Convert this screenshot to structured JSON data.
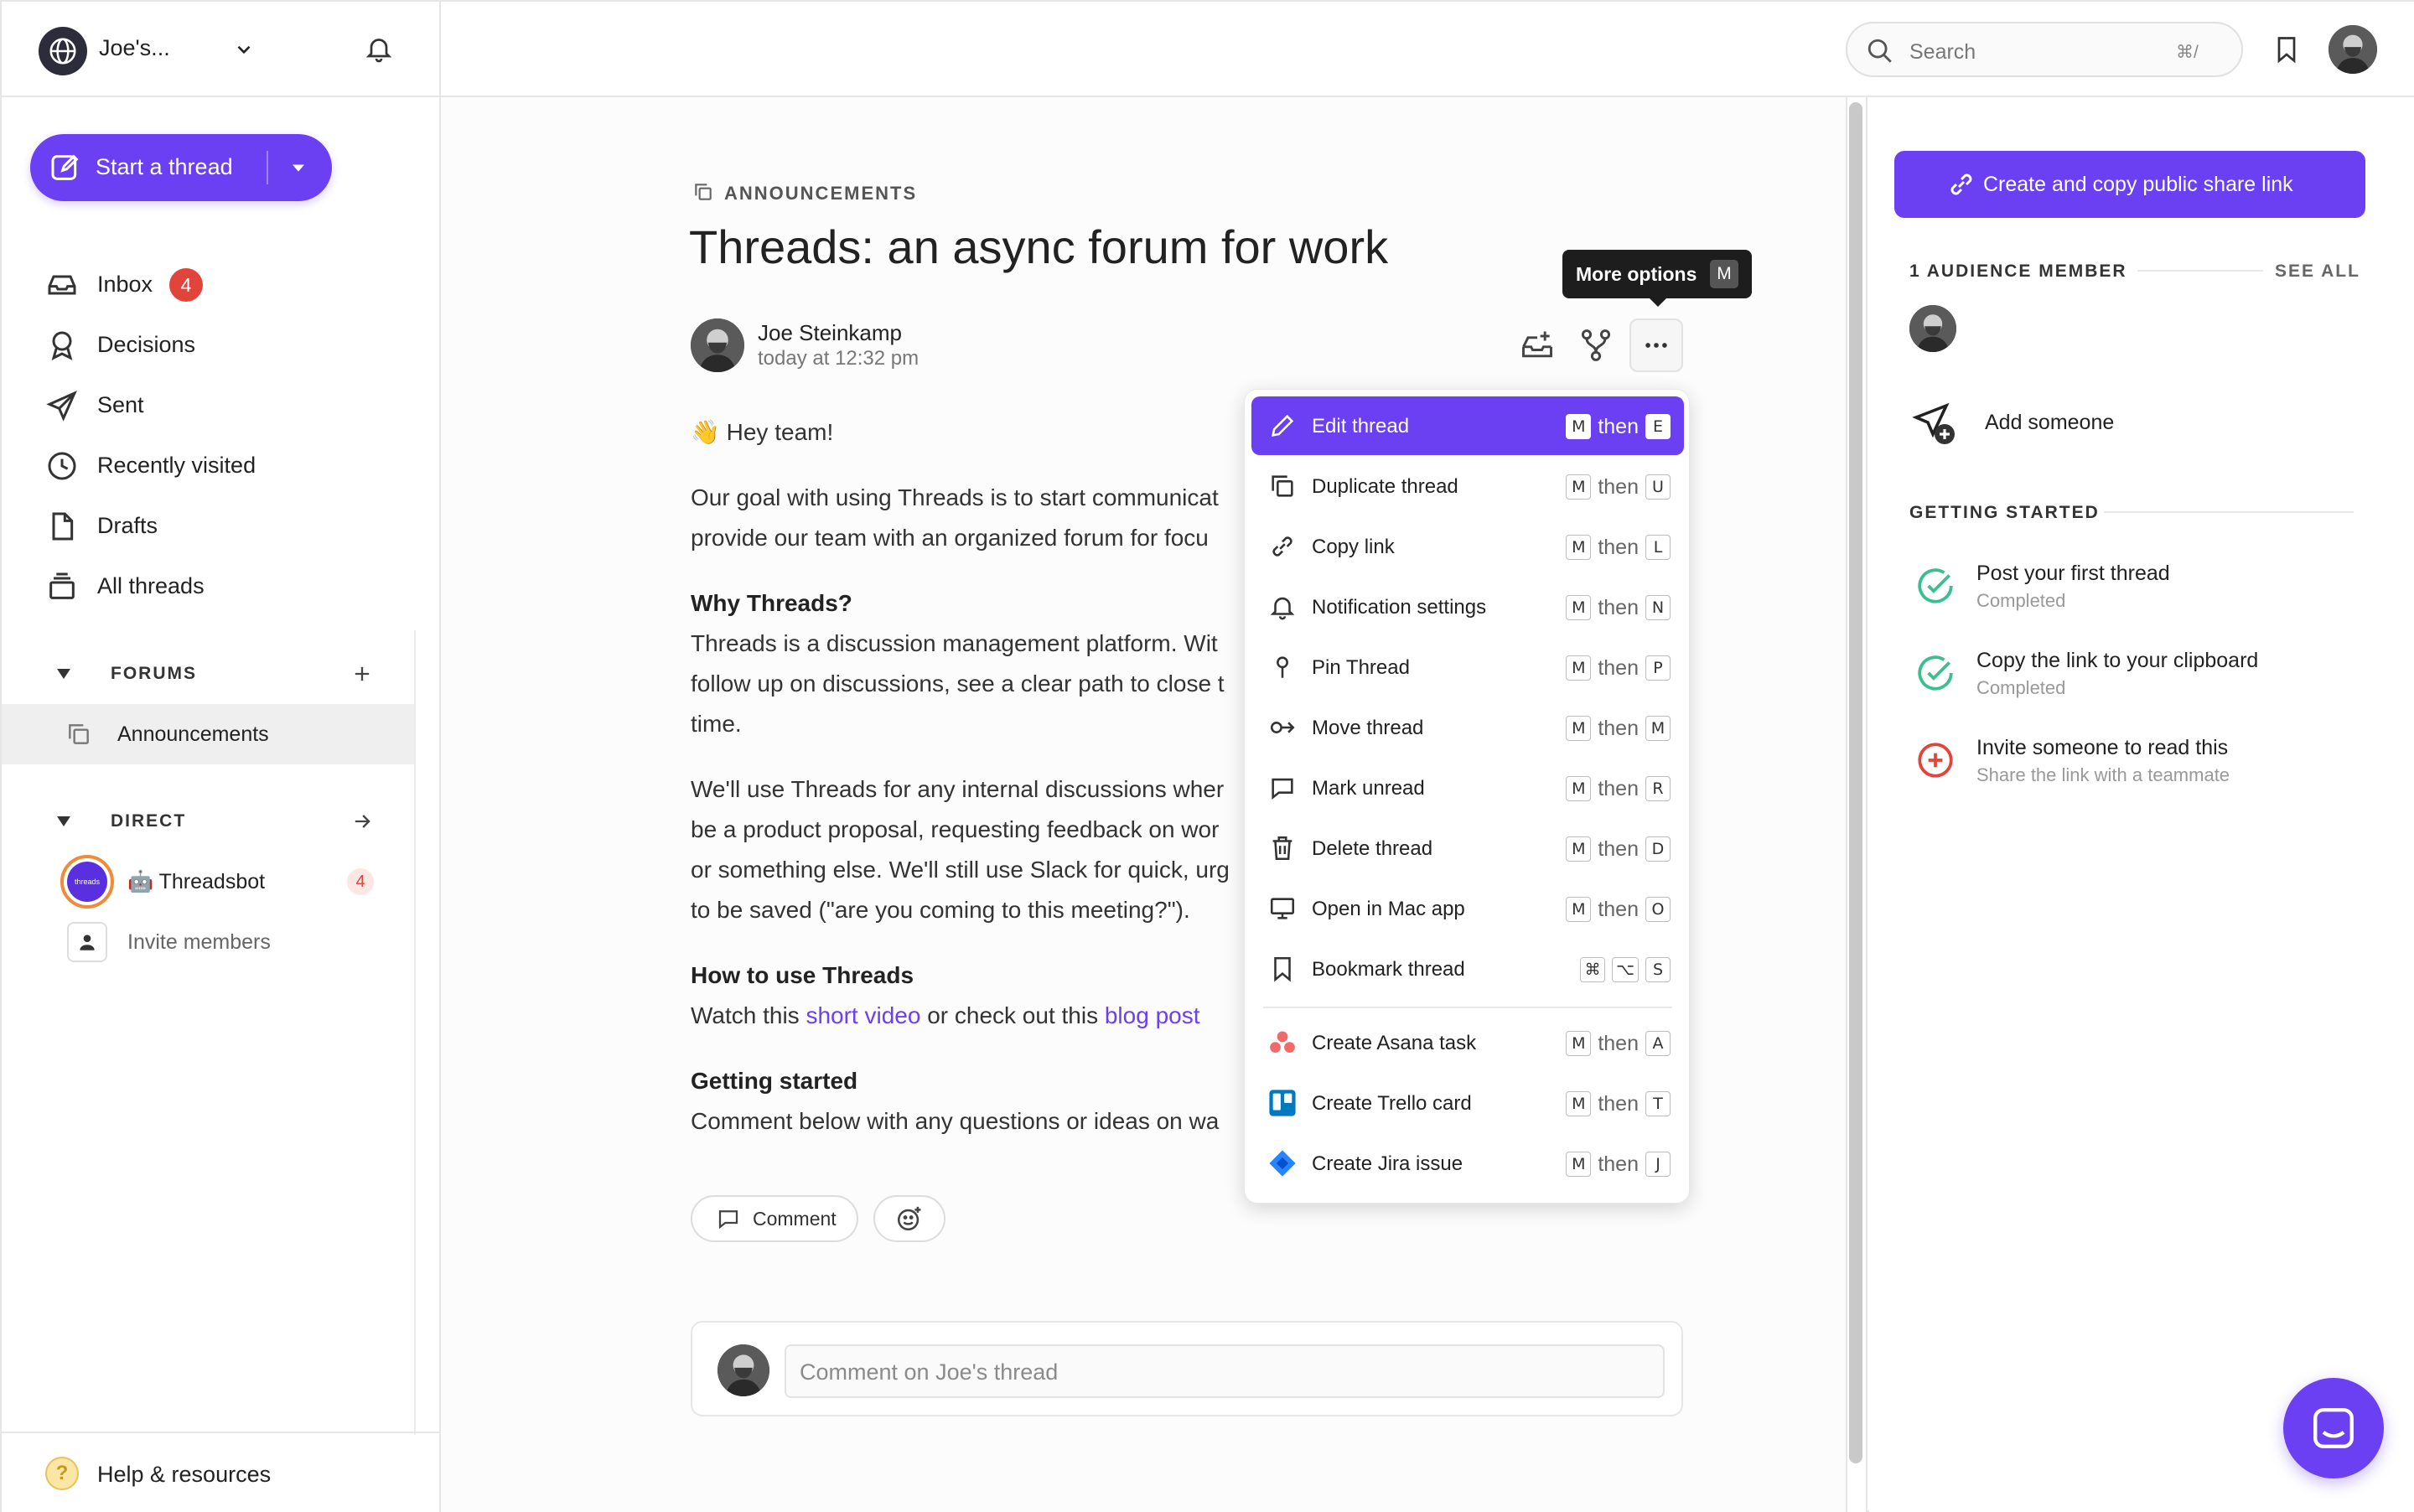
{
  "workspace": {
    "name": "Joe's..."
  },
  "sidebar": {
    "start_thread_label": "Start a thread",
    "nav": [
      {
        "label": "Inbox",
        "badge": "4",
        "icon": "inbox-icon"
      },
      {
        "label": "Decisions",
        "icon": "ribbon-icon"
      },
      {
        "label": "Sent",
        "icon": "send-icon"
      },
      {
        "label": "Recently visited",
        "icon": "clock-icon"
      },
      {
        "label": "Drafts",
        "icon": "file-icon"
      },
      {
        "label": "All threads",
        "icon": "stack-icon"
      }
    ],
    "forums_label": "FORUMS",
    "forums": [
      {
        "label": "Announcements"
      }
    ],
    "direct_label": "DIRECT",
    "direct": [
      {
        "name": "🤖 Threadsbot",
        "badge": "4",
        "avatar_text": "threads"
      }
    ],
    "invite_label": "Invite members",
    "help_label": "Help & resources"
  },
  "topbar": {
    "search_placeholder": "Search",
    "search_shortcut": "⌘/"
  },
  "thread": {
    "forum": "ANNOUNCEMENTS",
    "title": "Threads: an async forum for work",
    "author": "Joe Steinkamp",
    "time": "today at 12:32 pm",
    "greeting": "👋 Hey team!",
    "p1_line1": "Our goal with using Threads is to start communicat",
    "p1_line2": "provide our team with an organized forum for focu",
    "h_why": "Why Threads?",
    "why_line1": "Threads is a discussion management platform. Wit",
    "why_line2": "follow up on discussions, see a clear path to close t",
    "why_line3": "time.",
    "use_line1": "We'll use Threads for any internal discussions wher",
    "use_line2": "be a product proposal, requesting feedback on wor",
    "use_line3": "or something else. We'll still use Slack for quick, urg",
    "use_line4": "to be saved (\"are you coming to this meeting?\").",
    "h_how": "How to use Threads",
    "how_prefix": "Watch this ",
    "how_link1": "short video",
    "how_mid": " or check out this ",
    "how_link2": "blog post",
    "h_getting": "Getting started",
    "getting_line": "Comment below with any questions or ideas on wa",
    "comment_button": "Comment",
    "comment_placeholder": "Comment on Joe's thread"
  },
  "tooltip": {
    "label": "More options",
    "key": "M"
  },
  "menu": {
    "items": [
      {
        "label": "Edit thread",
        "icon": "pencil-icon",
        "keys": [
          "M",
          "then",
          "E"
        ],
        "active": true
      },
      {
        "label": "Duplicate thread",
        "icon": "duplicate-icon",
        "keys": [
          "M",
          "then",
          "U"
        ]
      },
      {
        "label": "Copy link",
        "icon": "link-icon",
        "keys": [
          "M",
          "then",
          "L"
        ]
      },
      {
        "label": "Notification settings",
        "icon": "bell-icon",
        "keys": [
          "M",
          "then",
          "N"
        ]
      },
      {
        "label": "Pin Thread",
        "icon": "pin-icon",
        "keys": [
          "M",
          "then",
          "P"
        ]
      },
      {
        "label": "Move thread",
        "icon": "move-icon",
        "keys": [
          "M",
          "then",
          "M"
        ]
      },
      {
        "label": "Mark unread",
        "icon": "comment-icon",
        "keys": [
          "M",
          "then",
          "R"
        ]
      },
      {
        "label": "Delete thread",
        "icon": "trash-icon",
        "keys": [
          "M",
          "then",
          "D"
        ]
      },
      {
        "label": "Open in Mac app",
        "icon": "monitor-icon",
        "keys": [
          "M",
          "then",
          "O"
        ]
      },
      {
        "label": "Bookmark thread",
        "icon": "bookmark-icon",
        "keys": [
          "⌘",
          "⌥",
          "S"
        ]
      },
      {
        "label": "Create Asana task",
        "icon": "asana-icon",
        "keys": [
          "M",
          "then",
          "A"
        ]
      },
      {
        "label": "Create Trello card",
        "icon": "trello-icon",
        "keys": [
          "M",
          "then",
          "T"
        ]
      },
      {
        "label": "Create Jira issue",
        "icon": "jira-icon",
        "keys": [
          "M",
          "then",
          "J"
        ]
      }
    ]
  },
  "right_panel": {
    "share_label": "Create and copy public share link",
    "audience_label": "1 AUDIENCE MEMBER",
    "see_all": "SEE ALL",
    "add_someone": "Add someone",
    "getting_started_label": "GETTING STARTED",
    "steps": [
      {
        "title": "Post your first thread",
        "sub": "Completed",
        "status": "done"
      },
      {
        "title": "Copy the link to your clipboard",
        "sub": "Completed",
        "status": "done"
      },
      {
        "title": "Invite someone to read this",
        "sub": "Share the link with a teammate",
        "status": "todo"
      }
    ]
  },
  "colors": {
    "accent": "#6b3ff2",
    "badge": "#e0443a",
    "success": "#3bbf8f"
  }
}
